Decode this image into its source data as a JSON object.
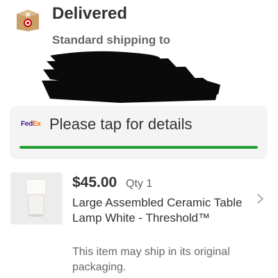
{
  "order": {
    "status_title": "Delivered",
    "shipping_text": "Standard shipping to"
  },
  "carrier": {
    "logo_fed": "Fed",
    "logo_ex": "Ex",
    "tap_text": "Please tap for details",
    "progress_fraction": 1.0,
    "progress_color": "#1e9e2e"
  },
  "item": {
    "price": "$45.00",
    "qty": "Qty 1",
    "name": "Large Assembled Ceramic Table Lamp White - Threshold™",
    "ship_note": "This item may ship in its original packaging."
  },
  "icons": {
    "package": "package-target-icon",
    "chevron": "chevron-right-icon"
  }
}
